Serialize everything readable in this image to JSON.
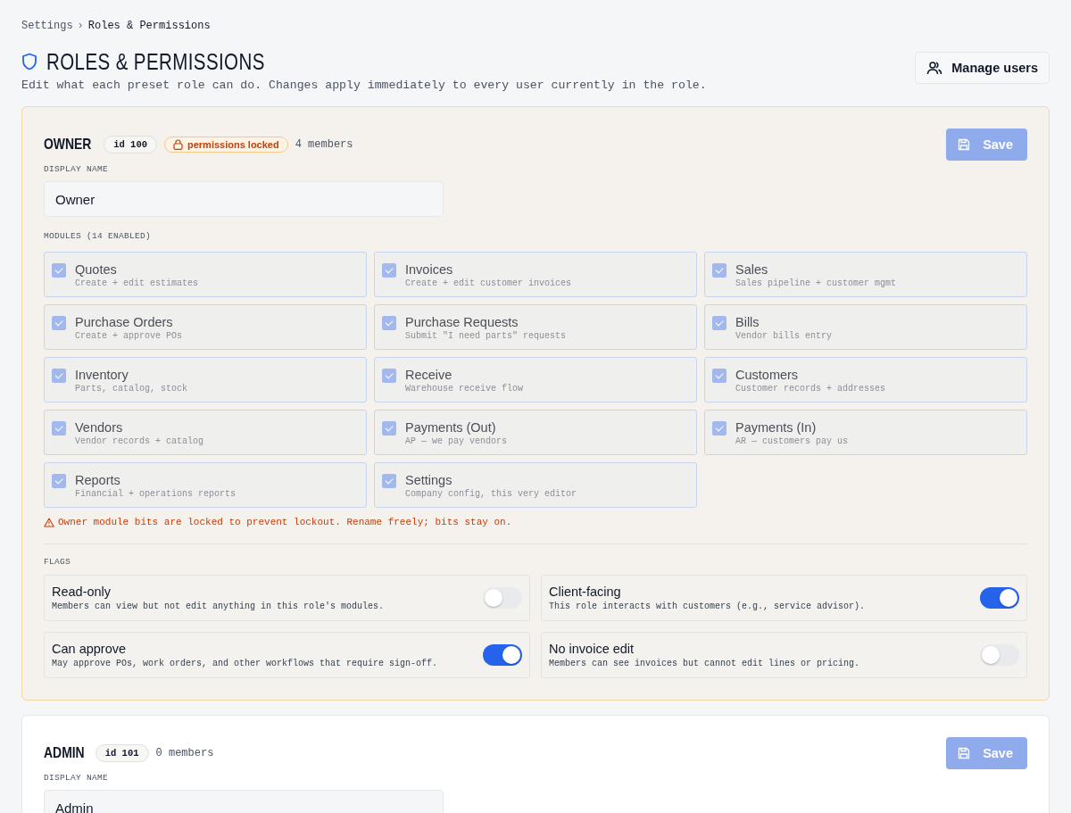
{
  "breadcrumb": [
    {
      "label": "Settings",
      "current": false
    },
    {
      "label": "Roles & Permissions",
      "current": true
    }
  ],
  "breadcrumb_separator": "›",
  "title": "ROLES & PERMISSIONS",
  "subtitle": "Edit what each preset role can do. Changes apply immediately to every user currently in the role.",
  "manage_users_button": "Manage users",
  "roles": [
    {
      "name": "OWNER",
      "id_badge": "id 100",
      "locked": true,
      "locked_badge": "permissions locked",
      "members": "4 members",
      "save_button": {
        "label": "Save",
        "disabled": true
      },
      "display_name_label": "DISPLAY NAME",
      "display_name": "Owner",
      "modules_label": "MODULES (14 ENABLED)",
      "modules": [
        {
          "name": "Quotes",
          "description": "Create + edit estimates",
          "checked": true
        },
        {
          "name": "Invoices",
          "description": "Create + edit customer invoices",
          "checked": true
        },
        {
          "name": "Sales",
          "description": "Sales pipeline + customer mgmt",
          "checked": true
        },
        {
          "name": "Purchase Orders",
          "description": "Create + approve POs",
          "checked": true
        },
        {
          "name": "Purchase Requests",
          "description": "Submit \"I need parts\" requests",
          "checked": true
        },
        {
          "name": "Bills",
          "description": "Vendor bills entry",
          "checked": true
        },
        {
          "name": "Inventory",
          "description": "Parts, catalog, stock",
          "checked": true
        },
        {
          "name": "Receive",
          "description": "Warehouse receive flow",
          "checked": true
        },
        {
          "name": "Customers",
          "description": "Customer records + addresses",
          "checked": true
        },
        {
          "name": "Vendors",
          "description": "Vendor records + catalog",
          "checked": true
        },
        {
          "name": "Payments (Out)",
          "description": "AP — we pay vendors",
          "checked": true
        },
        {
          "name": "Payments (In)",
          "description": "AR — customers pay us",
          "checked": true
        },
        {
          "name": "Reports",
          "description": "Financial + operations reports",
          "checked": true
        },
        {
          "name": "Settings",
          "description": "Company config, this very editor",
          "checked": true
        }
      ],
      "warning": "Owner module bits are locked to prevent lockout. Rename freely; bits stay on.",
      "flags_label": "FLAGS",
      "flags": [
        {
          "name": "Read-only",
          "description": "Members can view but not edit anything in this role's modules.",
          "on": false
        },
        {
          "name": "Client-facing",
          "description": "This role interacts with customers (e.g., service advisor).",
          "on": true
        },
        {
          "name": "Can approve",
          "description": "May approve POs, work orders, and other workflows that require sign-off.",
          "on": true
        },
        {
          "name": "No invoice edit",
          "description": "Members can see invoices but cannot edit lines or pricing.",
          "on": false
        }
      ]
    },
    {
      "name": "ADMIN",
      "id_badge": "id 101",
      "locked": false,
      "members": "0 members",
      "save_button": {
        "label": "Save",
        "disabled": true
      },
      "display_name_label": "DISPLAY NAME",
      "display_name": "Admin"
    }
  ]
}
